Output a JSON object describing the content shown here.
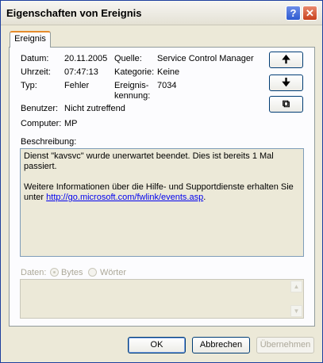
{
  "window": {
    "title": "Eigenschaften von Ereignis",
    "help": "?",
    "close": "✕"
  },
  "tab": {
    "label": "Ereignis"
  },
  "fields": {
    "datum_label": "Datum:",
    "datum": "20.11.2005",
    "uhrzeit_label": "Uhrzeit:",
    "uhrzeit": "07:47:13",
    "typ_label": "Typ:",
    "typ": "Fehler",
    "benutzer_label": "Benutzer:",
    "benutzer": "Nicht zutreffend",
    "computer_label": "Computer:",
    "computer": "MP",
    "quelle_label": "Quelle:",
    "quelle": "Service Control Manager",
    "kategorie_label": "Kategorie:",
    "kategorie": "Keine",
    "kennung_label_1": "Ereignis-",
    "kennung_label_2": "kennung:",
    "kennung": "7034"
  },
  "side_buttons": {
    "up": "🠉",
    "down": "🠋",
    "copy": "⧉"
  },
  "beschreibung": {
    "label": "Beschreibung:",
    "line1": "Dienst \"kavsvc\" wurde unerwartet beendet. Dies ist bereits 1 Mal passiert.",
    "line2": "Weitere Informationen über die Hilfe- und Supportdienste erhalten Sie",
    "line3_prefix": "unter ",
    "link": "http://go.microsoft.com/fwlink/events.asp",
    "line3_suffix": "."
  },
  "daten": {
    "label": "Daten:",
    "bytes": "Bytes",
    "woerter": "Wörter"
  },
  "buttons": {
    "ok": "OK",
    "cancel": "Abbrechen",
    "apply": "Übernehmen"
  }
}
